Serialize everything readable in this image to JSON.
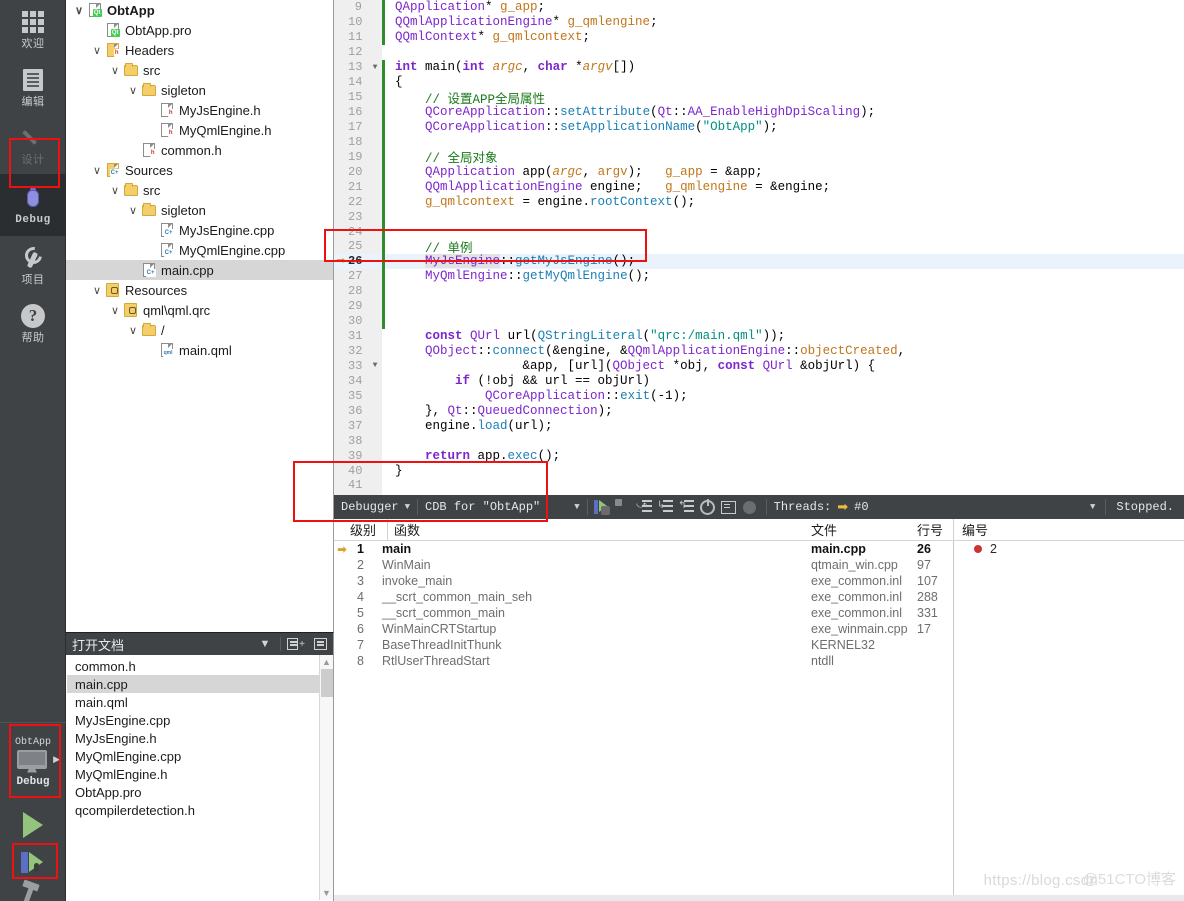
{
  "modebar": {
    "items": [
      {
        "label": "欢迎",
        "icon": "grid-icon",
        "state": "normal"
      },
      {
        "label": "编辑",
        "icon": "editor-icon",
        "state": "normal"
      },
      {
        "label": "设计",
        "icon": "pencil-icon",
        "state": "disabled"
      },
      {
        "label": "Debug",
        "icon": "bug-icon",
        "state": "selected"
      },
      {
        "label": "项目",
        "icon": "wrench-icon",
        "state": "normal"
      },
      {
        "label": "帮助",
        "icon": "question-icon",
        "state": "normal"
      }
    ],
    "kit": {
      "project": "ObtApp",
      "config": "Debug",
      "icon": "monitor-icon"
    },
    "run_label": "run-triangle-icon",
    "debug_label": "start-debugging-icon",
    "build_label": "hammer-icon"
  },
  "tree": {
    "rows": [
      {
        "label": "ObtApp",
        "indent": 0,
        "chev": "open",
        "icon": "qt-project-icon",
        "bold": true,
        "selected": false
      },
      {
        "label": "ObtApp.pro",
        "indent": 1,
        "chev": "none",
        "icon": "pro-file-icon",
        "bold": false,
        "selected": false
      },
      {
        "label": "Headers",
        "indent": 1,
        "chev": "open",
        "icon": "headers-icon",
        "bold": false,
        "selected": false
      },
      {
        "label": "src",
        "indent": 2,
        "chev": "open",
        "icon": "folder-icon",
        "bold": false,
        "selected": false
      },
      {
        "label": "sigleton",
        "indent": 3,
        "chev": "open",
        "icon": "folder-icon",
        "bold": false,
        "selected": false
      },
      {
        "label": "MyJsEngine.h",
        "indent": 4,
        "chev": "none",
        "icon": "h-file-icon",
        "bold": false,
        "selected": false
      },
      {
        "label": "MyQmlEngine.h",
        "indent": 4,
        "chev": "none",
        "icon": "h-file-icon",
        "bold": false,
        "selected": false
      },
      {
        "label": "common.h",
        "indent": 3,
        "chev": "none",
        "icon": "h-file-icon",
        "bold": false,
        "selected": false
      },
      {
        "label": "Sources",
        "indent": 1,
        "chev": "open",
        "icon": "sources-icon",
        "bold": false,
        "selected": false
      },
      {
        "label": "src",
        "indent": 2,
        "chev": "open",
        "icon": "folder-icon",
        "bold": false,
        "selected": false
      },
      {
        "label": "sigleton",
        "indent": 3,
        "chev": "open",
        "icon": "folder-icon",
        "bold": false,
        "selected": false
      },
      {
        "label": "MyJsEngine.cpp",
        "indent": 4,
        "chev": "none",
        "icon": "cpp-file-icon",
        "bold": false,
        "selected": false
      },
      {
        "label": "MyQmlEngine.cpp",
        "indent": 4,
        "chev": "none",
        "icon": "cpp-file-icon",
        "bold": false,
        "selected": false
      },
      {
        "label": "main.cpp",
        "indent": 3,
        "chev": "none",
        "icon": "cpp-file-icon",
        "bold": false,
        "selected": true
      },
      {
        "label": "Resources",
        "indent": 1,
        "chev": "open",
        "icon": "resources-icon",
        "bold": false,
        "selected": false
      },
      {
        "label": "qml\\qml.qrc",
        "indent": 2,
        "chev": "open",
        "icon": "qrc-file-icon",
        "bold": false,
        "selected": false
      },
      {
        "label": "/",
        "indent": 3,
        "chev": "open",
        "icon": "folder-icon",
        "bold": false,
        "selected": false
      },
      {
        "label": "main.qml",
        "indent": 4,
        "chev": "none",
        "icon": "qml-file-icon",
        "bold": false,
        "selected": false
      }
    ]
  },
  "opendocs": {
    "title": "打开文档",
    "dropdown_icon": "chevron-down-icon",
    "split_icon": "split-editor-icon",
    "close_icon": "close-split-icon",
    "files": [
      {
        "name": "common.h",
        "selected": false
      },
      {
        "name": "main.cpp",
        "selected": true
      },
      {
        "name": "main.qml",
        "selected": false
      },
      {
        "name": "MyJsEngine.cpp",
        "selected": false
      },
      {
        "name": "MyJsEngine.h",
        "selected": false
      },
      {
        "name": "MyQmlEngine.cpp",
        "selected": false
      },
      {
        "name": "MyQmlEngine.h",
        "selected": false
      },
      {
        "name": "ObtApp.pro",
        "selected": false
      },
      {
        "name": "qcompilerdetection.h",
        "selected": false
      }
    ]
  },
  "editor": {
    "first_line": 9,
    "current_line": 26,
    "lines": [
      {
        "n": 9,
        "fold": "",
        "changed": true,
        "html": "<span class='c-type'>QApplication</span><span class='c-plain'>* </span><span class='c-var'>g_app</span><span class='c-plain'>;</span>",
        "indent": 0
      },
      {
        "n": 10,
        "fold": "",
        "changed": true,
        "html": "<span class='c-type'>QQmlApplicationEngine</span><span class='c-plain'>* </span><span class='c-var'>g_qmlengine</span><span class='c-plain'>;</span>",
        "indent": 0
      },
      {
        "n": 11,
        "fold": "",
        "changed": true,
        "html": "<span class='c-type'>QQmlContext</span><span class='c-plain'>* </span><span class='c-var'>g_qmlcontext</span><span class='c-plain'>;</span>",
        "indent": 0
      },
      {
        "n": 12,
        "fold": "",
        "changed": false,
        "html": "",
        "indent": 0
      },
      {
        "n": 13,
        "fold": "▼",
        "changed": true,
        "html": "<span class='c-kw'>int</span> <span class='c-plain'>main(</span><span class='c-kw'>int</span> <span class='c-italic'>argc</span><span class='c-plain'>, </span><span class='c-kw'>char</span> <span class='c-plain'>*</span><span class='c-italic'>argv</span><span class='c-plain'>[])</span>",
        "indent": 0
      },
      {
        "n": 14,
        "fold": "",
        "changed": true,
        "html": "<span class='c-plain'>{</span>",
        "indent": 0
      },
      {
        "n": 15,
        "fold": "",
        "changed": true,
        "html": "<span class='c-cmt'>    // 设置APP全局属性</span>",
        "indent": 0
      },
      {
        "n": 16,
        "fold": "",
        "changed": true,
        "html": "<span class='c-plain'>    </span><span class='c-type'>QCoreApplication</span><span class='c-plain'>::</span><span class='c-fn'>setAttribute</span><span class='c-plain'>(</span><span class='c-type'>Qt</span><span class='c-plain'>::</span><span class='c-type'>AA_EnableHighDpiScaling</span><span class='c-plain'>);</span>",
        "indent": 0
      },
      {
        "n": 17,
        "fold": "",
        "changed": true,
        "html": "<span class='c-plain'>    </span><span class='c-type'>QCoreApplication</span><span class='c-plain'>::</span><span class='c-fn'>setApplicationName</span><span class='c-plain'>(</span><span class='c-str'>\"ObtApp\"</span><span class='c-plain'>);</span>",
        "indent": 0
      },
      {
        "n": 18,
        "fold": "",
        "changed": true,
        "html": "",
        "indent": 0
      },
      {
        "n": 19,
        "fold": "",
        "changed": true,
        "html": "<span class='c-cmt'>    // 全局对象</span>",
        "indent": 0
      },
      {
        "n": 20,
        "fold": "",
        "changed": true,
        "html": "<span class='c-plain'>    </span><span class='c-type'>QApplication</span><span class='c-plain'> app(</span><span class='c-italic'>argc</span><span class='c-plain'>, </span><span class='c-var'>argv</span><span class='c-plain'>);   </span><span class='c-var'>g_app</span><span class='c-plain'> = &app;</span>",
        "indent": 0
      },
      {
        "n": 21,
        "fold": "",
        "changed": true,
        "html": "<span class='c-plain'>    </span><span class='c-type'>QQmlApplicationEngine</span><span class='c-plain'> engine;   </span><span class='c-var'>g_qmlengine</span><span class='c-plain'> = &engine;</span>",
        "indent": 0
      },
      {
        "n": 22,
        "fold": "",
        "changed": true,
        "html": "<span class='c-plain'>    </span><span class='c-var'>g_qmlcontext</span><span class='c-plain'> = engine.</span><span class='c-fn'>rootContext</span><span class='c-plain'>();</span>",
        "indent": 0
      },
      {
        "n": 23,
        "fold": "",
        "changed": true,
        "html": "",
        "indent": 0
      },
      {
        "n": 24,
        "fold": "",
        "changed": true,
        "html": "",
        "indent": 0
      },
      {
        "n": 25,
        "fold": "",
        "changed": true,
        "html": "<span class='c-cmt'>    // 单例</span>",
        "indent": 0
      },
      {
        "n": 26,
        "fold": "",
        "changed": true,
        "html": "<span class='c-plain'>    </span><span class='c-type c-hl'>MyJsEngine</span><span class='c-plain'>::</span><span class='c-fn'>getMyJsEngine</span><span class='c-plain'>();</span>",
        "indent": 0
      },
      {
        "n": 27,
        "fold": "",
        "changed": true,
        "html": "<span class='c-plain'>    </span><span class='c-type'>MyQmlEngine</span><span class='c-plain'>::</span><span class='c-fn'>getMyQmlEngine</span><span class='c-plain'>();</span>",
        "indent": 0
      },
      {
        "n": 28,
        "fold": "",
        "changed": true,
        "html": "",
        "indent": 0
      },
      {
        "n": 29,
        "fold": "",
        "changed": true,
        "html": "",
        "indent": 0
      },
      {
        "n": 30,
        "fold": "",
        "changed": true,
        "html": "",
        "indent": 0
      },
      {
        "n": 31,
        "fold": "",
        "changed": false,
        "html": "<span class='c-plain'>    </span><span class='c-kw'>const</span> <span class='c-type'>QUrl</span><span class='c-plain'> url(</span><span class='c-fn'>QStringLiteral</span><span class='c-plain'>(</span><span class='c-str'>\"qrc:/main.qml\"</span><span class='c-plain'>));</span>",
        "indent": 0
      },
      {
        "n": 32,
        "fold": "",
        "changed": false,
        "html": "<span class='c-plain'>    </span><span class='c-type'>QObject</span><span class='c-plain'>::</span><span class='c-fn'>connect</span><span class='c-plain'>(&engine, &</span><span class='c-type'>QQmlApplicationEngine</span><span class='c-plain'>::</span><span class='c-var'>objectCreated</span><span class='c-plain'>,</span>",
        "indent": 0
      },
      {
        "n": 33,
        "fold": "▼",
        "changed": false,
        "html": "<span class='c-plain'>                 &app, [url](</span><span class='c-type'>QObject</span><span class='c-plain'> *obj, </span><span class='c-kw'>const</span> <span class='c-type'>QUrl</span><span class='c-plain'> &objUrl) {</span>",
        "indent": 0
      },
      {
        "n": 34,
        "fold": "",
        "changed": false,
        "html": "<span class='c-plain'>        </span><span class='c-kw'>if</span><span class='c-plain'> (!obj && url == objUrl)</span>",
        "indent": 0
      },
      {
        "n": 35,
        "fold": "",
        "changed": false,
        "html": "<span class='c-plain'>            </span><span class='c-type'>QCoreApplication</span><span class='c-plain'>::</span><span class='c-fn'>exit</span><span class='c-plain'>(-</span><span class='c-num'>1</span><span class='c-plain'>);</span>",
        "indent": 0
      },
      {
        "n": 36,
        "fold": "",
        "changed": false,
        "html": "<span class='c-plain'>    }, </span><span class='c-type'>Qt</span><span class='c-plain'>::</span><span class='c-type'>QueuedConnection</span><span class='c-plain'>);</span>",
        "indent": 0
      },
      {
        "n": 37,
        "fold": "",
        "changed": false,
        "html": "<span class='c-plain'>    engine.</span><span class='c-fn'>load</span><span class='c-plain'>(url);</span>",
        "indent": 0
      },
      {
        "n": 38,
        "fold": "",
        "changed": false,
        "html": "",
        "indent": 0
      },
      {
        "n": 39,
        "fold": "",
        "changed": false,
        "html": "<span class='c-plain'>    </span><span class='c-kw'>return</span><span class='c-plain'> app.</span><span class='c-fn'>exec</span><span class='c-plain'>();</span>",
        "indent": 0
      },
      {
        "n": 40,
        "fold": "",
        "changed": false,
        "html": "<span class='c-plain'>}</span>",
        "indent": 0
      },
      {
        "n": 41,
        "fold": "",
        "changed": false,
        "html": "",
        "indent": 0
      }
    ]
  },
  "debug_toolbar": {
    "view_label": "Debugger",
    "engine_label": "CDB for \"ObtApp\"",
    "threads_label": "Threads:",
    "thread_value": "#0",
    "status": "Stopped.",
    "buttons": [
      {
        "name": "continue-debug-icon"
      },
      {
        "name": "stop-debugger-icon"
      },
      {
        "name": "step-over-icon"
      },
      {
        "name": "step-into-icon"
      },
      {
        "name": "step-out-icon"
      },
      {
        "name": "reset-debugger-icon"
      },
      {
        "name": "toggle-panel-icon"
      },
      {
        "name": "record-icon"
      }
    ]
  },
  "stack": {
    "headers": {
      "level": "级别",
      "function": "函数",
      "file": "文件",
      "line": "行号"
    },
    "rows": [
      {
        "level": "1",
        "function": "main",
        "file": "main.cpp",
        "line": "26",
        "active": true
      },
      {
        "level": "2",
        "function": "WinMain",
        "file": "qtmain_win.cpp",
        "line": "97",
        "active": false
      },
      {
        "level": "3",
        "function": "invoke_main",
        "file": "exe_common.inl",
        "line": "107",
        "active": false
      },
      {
        "level": "4",
        "function": "__scrt_common_main_seh",
        "file": "exe_common.inl",
        "line": "288",
        "active": false
      },
      {
        "level": "5",
        "function": "__scrt_common_main",
        "file": "exe_common.inl",
        "line": "331",
        "active": false
      },
      {
        "level": "6",
        "function": "WinMainCRTStartup",
        "file": "exe_winmain.cpp",
        "line": "17",
        "active": false
      },
      {
        "level": "7",
        "function": "BaseThreadInitThunk",
        "file": "KERNEL32",
        "line": "",
        "active": false
      },
      {
        "level": "8",
        "function": "RtlUserThreadStart",
        "file": "ntdll",
        "line": "",
        "active": false
      }
    ]
  },
  "breakpoints": {
    "header": "编号",
    "rows": [
      {
        "number": "2",
        "color": "#cc3333"
      }
    ]
  },
  "watermark": {
    "left": "https://blog.csdn",
    "right": "@51CTO博客"
  },
  "colors": {
    "accent_red": "#ee1111",
    "chrome_dark": "#3f4346",
    "selection": "#d6d6d6",
    "current_line": "#eaf2fb",
    "changebar_green": "#2e8b2e",
    "breakpoint_red": "#cc3333",
    "thread_arrow": "#ecbf3a"
  }
}
